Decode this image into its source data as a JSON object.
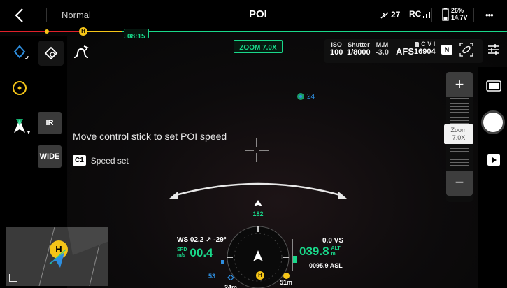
{
  "topbar": {
    "mode": "Normal",
    "title": "POI",
    "timer": "08:15",
    "satellites": "27",
    "rc_label": "RC",
    "battery_percent": "26%",
    "battery_voltage": "14.7V",
    "more": "•••",
    "home_marker": "H"
  },
  "left_controls": {
    "ir_label": "IR",
    "wide_label": "WIDE"
  },
  "camera": {
    "zoom_badge": "ZOOM 7.0X",
    "iso_label": "ISO",
    "iso_value": "100",
    "shutter_label": "Shutter",
    "shutter_value": "1/8000",
    "ev_label": "M.M",
    "ev_value": "-3.0",
    "focus_mode": "AFS",
    "storage_label": "C V I",
    "storage_value": "16904",
    "photo_mode_badge": "N"
  },
  "hints": {
    "poi_speed_hint": "Move control stick to set POI speed",
    "key_label": "C1",
    "key_action": "Speed set"
  },
  "target": {
    "distance_label": "24"
  },
  "zoom_panel": {
    "plus": "+",
    "minus": "−",
    "zoom_label": "Zoom",
    "zoom_value": "7.0X"
  },
  "telemetry": {
    "heading_above": "182",
    "wind_label": "WS 02.2",
    "wind_dir": "↗ -29°",
    "spd_label_top": "SPD",
    "spd_label_bottom": "m/s",
    "speed_value": "00.4",
    "vs_value": "0.0 VS",
    "alt_value": "039.8",
    "alt_label_top": "ALT",
    "alt_label_bottom": "m",
    "asl_value": "0095.9 ASL",
    "home_indicator_value": "53",
    "dist_left": "24m",
    "dist_right": "51m",
    "home_marker": "H"
  },
  "minimap": {
    "home_marker": "H"
  },
  "colors": {
    "accent_green": "#19d88a",
    "home_yellow": "#f5c518",
    "limit_red": "#e0202a",
    "target_blue": "#2e8fe0"
  }
}
